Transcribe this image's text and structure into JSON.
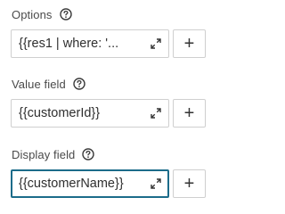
{
  "fields": [
    {
      "label": "Options",
      "value": "{{res1 | where: '...",
      "help_icon": "question-circle-icon",
      "expand_icon": "expand-arrows-icon",
      "add_label": "+"
    },
    {
      "label": "Value field",
      "value": "{{customerId}}",
      "help_icon": "question-circle-icon",
      "expand_icon": "expand-arrows-icon",
      "add_label": "+"
    },
    {
      "label": "Display field",
      "value": "{{customerName}}",
      "help_icon": "question-circle-icon",
      "expand_icon": "expand-arrows-icon",
      "add_label": "+",
      "focused": true
    }
  ],
  "colors": {
    "focus_border": "#1c6c8a",
    "border": "#cfcfcf",
    "label_text": "#4a4a4a"
  }
}
